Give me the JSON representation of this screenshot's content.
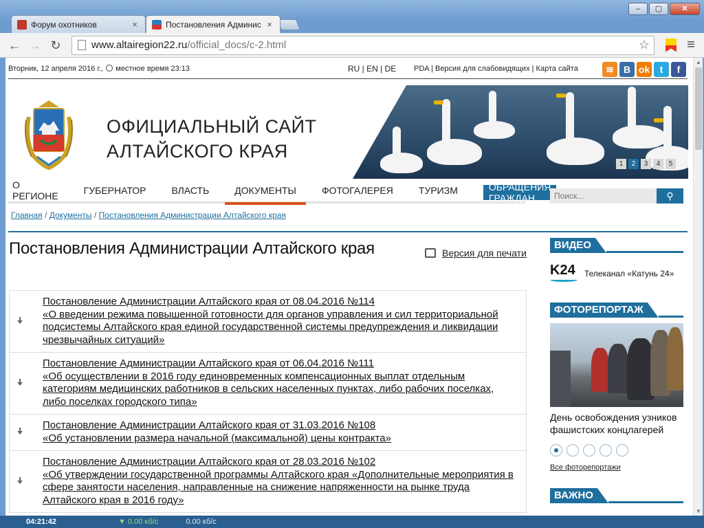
{
  "browser": {
    "tabs": [
      {
        "title": "Форум охотников",
        "active": false
      },
      {
        "title": "Постановления Админис",
        "active": true
      }
    ],
    "url_host": "www.altairegion22.ru",
    "url_path": "/official_docs/c-2.html",
    "window_buttons": [
      "–",
      "▢",
      "✕"
    ]
  },
  "topbar": {
    "date": "Вторник, 12 апреля 2016 г.,",
    "local_time": "местное время 23:13",
    "langs": "RU  |  EN  |  DE",
    "links": "PDA  |  Версия для слабовидящих  |  Карта сайта",
    "social": [
      {
        "name": "rss-icon",
        "glyph": "≋",
        "color": "#f08a24"
      },
      {
        "name": "vk-icon",
        "glyph": "В",
        "color": "#3b6ea5"
      },
      {
        "name": "odnoklassniki-icon",
        "glyph": "ok",
        "color": "#f07d00"
      },
      {
        "name": "twitter-icon",
        "glyph": "t",
        "color": "#2aa9e0"
      },
      {
        "name": "facebook-icon",
        "glyph": "f",
        "color": "#3b5998"
      }
    ]
  },
  "site": {
    "title_line1": "ОФИЦИАЛЬНЫЙ САЙТ",
    "title_line2": "АЛТАЙСКОГО КРАЯ"
  },
  "banner": {
    "pages": [
      "1",
      "2",
      "3",
      "4",
      "5"
    ],
    "active_page": "2"
  },
  "nav": [
    {
      "label": "О регионе",
      "state": "normal"
    },
    {
      "label": "Губернатор",
      "state": "normal"
    },
    {
      "label": "Власть",
      "state": "normal"
    },
    {
      "label": "Документы",
      "state": "active"
    },
    {
      "label": "Фотогалерея",
      "state": "normal"
    },
    {
      "label": "Туризм",
      "state": "normal"
    },
    {
      "label": "Обращения граждан",
      "state": "highlight"
    }
  ],
  "search": {
    "placeholder": "Поиск...",
    "button": "🔍"
  },
  "breadcrumbs": {
    "home": "Главная",
    "sep": " / ",
    "docs": "Документы",
    "current": "Постановления Администрации Алтайского края"
  },
  "page": {
    "title": "Постановления Администрации Алтайского края",
    "print_label": "Версия для печати"
  },
  "documents": [
    {
      "title": "Постановление Администрации Алтайского края от 08.04.2016 №114",
      "subject": "«О введении режима повышенной готовности для органов управления и сил территориальной подсистемы Алтайского края единой государственной системы предупреждения и ликвидации чрезвычайных ситуаций»"
    },
    {
      "title": "Постановление Администрации Алтайского края от 06.04.2016 №111",
      "subject": "«Об осуществлении в 2016 году единовременных компенсационных выплат отдельным категориям медицинских работников в сельских населенных пунктах, либо рабочих поселках, либо поселках городского типа»"
    },
    {
      "title": "Постановление Администрации Алтайского края от 31.03.2016 №108",
      "subject": "«Об установлении размера начальной (максимальной) цены контракта»"
    },
    {
      "title": "Постановление Администрации Алтайского края от 28.03.2016 №102",
      "subject": "«Об утверждении государственной программы Алтайского края «Дополнительные мероприятия в сфере занятости населения, направленные на снижение напряженности на рынке труда Алтайского края в 2016 году»"
    }
  ],
  "sidebar": {
    "video": {
      "heading": "ВИДЕО",
      "logo": "K24",
      "channel": "Телеканал «Катунь 24»"
    },
    "photo": {
      "heading": "ФОТОРЕПОРТАЖ",
      "caption": "День освобождения узников фашистских концлагерей",
      "all_link": "Все фоторепортажи"
    },
    "important": {
      "heading": "ВАЖНО"
    }
  },
  "statusbar": {
    "time": "04:21:42",
    "down": "▼ 0.00 кб/с",
    "up": "0.00 кб/с"
  }
}
